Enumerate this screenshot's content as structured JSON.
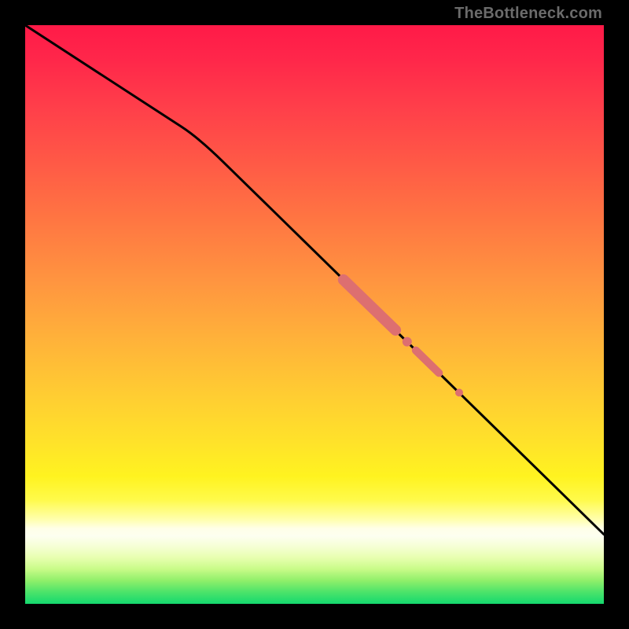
{
  "attribution": "TheBottleneck.com",
  "colors": {
    "page_bg": "#000000",
    "line": "#000000",
    "marker_fill": "#dd6f70",
    "marker_stroke": "#dd6f70"
  },
  "chart_data": {
    "type": "line",
    "title": "",
    "xlabel": "",
    "ylabel": "",
    "xlim": [
      0,
      100
    ],
    "ylim": [
      0,
      100
    ],
    "grid": false,
    "legend": false,
    "background_gradient": {
      "orientation": "vertical",
      "stops": [
        {
          "pos": 0.0,
          "color": "#ff1a48"
        },
        {
          "pos": 0.5,
          "color": "#ffb13a"
        },
        {
          "pos": 0.78,
          "color": "#fff320"
        },
        {
          "pos": 0.87,
          "color": "#ffffe8"
        },
        {
          "pos": 0.94,
          "color": "#c8fb88"
        },
        {
          "pos": 1.0,
          "color": "#14d96e"
        }
      ]
    },
    "series": [
      {
        "name": "curve",
        "style": "line",
        "points": [
          {
            "x": 0,
            "y": 100
          },
          {
            "x": 30,
            "y": 80.5
          },
          {
            "x": 100,
            "y": 12
          }
        ]
      }
    ],
    "markers": [
      {
        "name": "highlight-segment-1",
        "type": "segment",
        "x1": 55,
        "y1": 56.0,
        "x2": 64,
        "y2": 47.3,
        "width": 14
      },
      {
        "name": "highlight-dot-1",
        "type": "dot",
        "x": 66,
        "y": 45.3,
        "r": 6
      },
      {
        "name": "highlight-segment-2",
        "type": "segment",
        "x1": 67.5,
        "y1": 43.8,
        "x2": 71.5,
        "y2": 39.9,
        "width": 10
      },
      {
        "name": "highlight-dot-2",
        "type": "dot",
        "x": 75,
        "y": 36.5,
        "r": 5
      }
    ]
  }
}
